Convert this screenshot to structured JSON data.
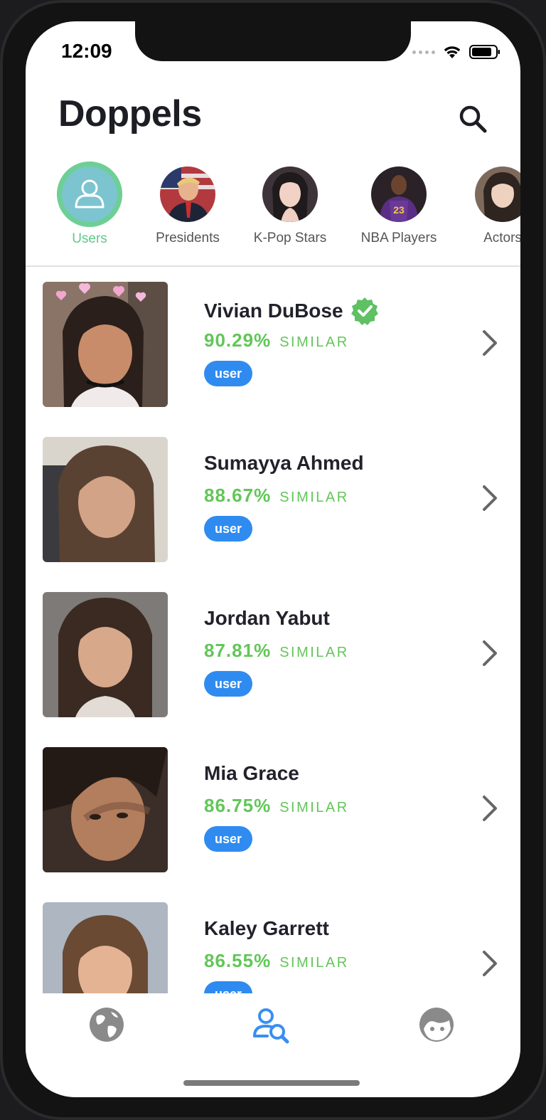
{
  "status_bar": {
    "time": "12:09"
  },
  "header": {
    "title": "Doppels"
  },
  "categories": [
    {
      "label": "Users",
      "active": true
    },
    {
      "label": "Presidents",
      "active": false
    },
    {
      "label": "K-Pop Stars",
      "active": false
    },
    {
      "label": "NBA Players",
      "active": false
    },
    {
      "label": "Actors",
      "active": false
    }
  ],
  "results": [
    {
      "name": "Vivian DuBose",
      "percent": "90.29%",
      "similar_label": "SIMILAR",
      "badge": "user",
      "verified": true
    },
    {
      "name": "Sumayya Ahmed",
      "percent": "88.67%",
      "similar_label": "SIMILAR",
      "badge": "user",
      "verified": false
    },
    {
      "name": "Jordan Yabut",
      "percent": "87.81%",
      "similar_label": "SIMILAR",
      "badge": "user",
      "verified": false
    },
    {
      "name": "Mia Grace",
      "percent": "86.75%",
      "similar_label": "SIMILAR",
      "badge": "user",
      "verified": false
    },
    {
      "name": "Kaley Garrett",
      "percent": "86.55%",
      "similar_label": "SIMILAR",
      "badge": "user",
      "verified": false
    }
  ],
  "tabbar": {
    "tabs": [
      {
        "icon": "globe-icon",
        "active": false
      },
      {
        "icon": "user-search-icon",
        "active": true
      },
      {
        "icon": "face-icon",
        "active": false
      }
    ]
  },
  "colors": {
    "accent_green": "#62c658",
    "active_tab_green": "#6ecf96",
    "badge_blue": "#2f8bf0",
    "title_text": "#1d1d24"
  }
}
